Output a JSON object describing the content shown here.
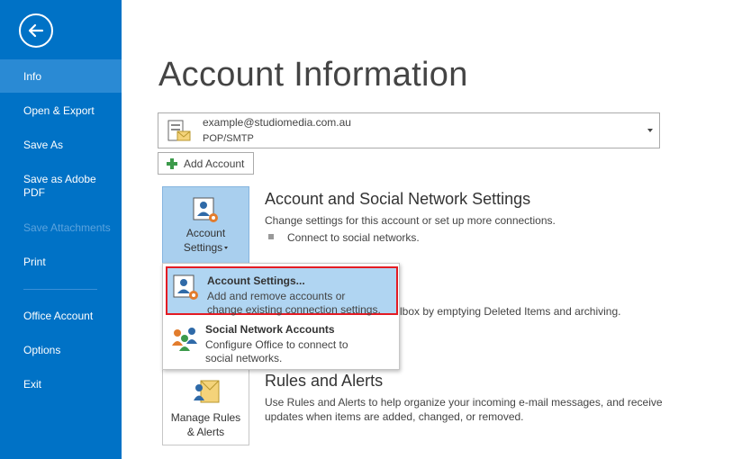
{
  "sidebar": {
    "items": [
      {
        "label": "Info"
      },
      {
        "label": "Open & Export"
      },
      {
        "label": "Save As"
      },
      {
        "label": "Save as Adobe PDF"
      },
      {
        "label": "Save Attachments"
      },
      {
        "label": "Print"
      },
      {
        "label": "Office Account"
      },
      {
        "label": "Options"
      },
      {
        "label": "Exit"
      }
    ],
    "active": "Info",
    "disabled": "Save Attachments"
  },
  "main": {
    "title": "Account Information",
    "account": {
      "email": "example@studiomedia.com.au",
      "type": "POP/SMTP"
    },
    "add_account_label": "Add Account",
    "account_settings_tile": {
      "line1": "Account",
      "line2": "Settings"
    },
    "account_section": {
      "heading": "Account and Social Network Settings",
      "description": "Change settings for this account or set up more connections.",
      "bullet": "Connect to social networks."
    },
    "cleanup_partial": "lbox by emptying Deleted Items and archiving.",
    "rules_tile": {
      "line1": "Manage Rules",
      "line2": "& Alerts"
    },
    "rules_section": {
      "heading": "Rules and Alerts",
      "line1": "Use Rules and Alerts to help organize your incoming e-mail messages, and receive",
      "line2": "updates when items are added, changed, or removed."
    }
  },
  "dropdown": {
    "items": [
      {
        "title": "Account Settings...",
        "desc1": "Add and remove accounts or",
        "desc2": "change existing connection settings."
      },
      {
        "title": "Social Network Accounts",
        "desc1": "Configure Office to connect to",
        "desc2": "social networks."
      }
    ]
  },
  "colors": {
    "sidebar": "#0072c6",
    "active_item": "#2a8ad4",
    "highlight": "#b0d5f2",
    "highlight_border": "#e31b23"
  }
}
